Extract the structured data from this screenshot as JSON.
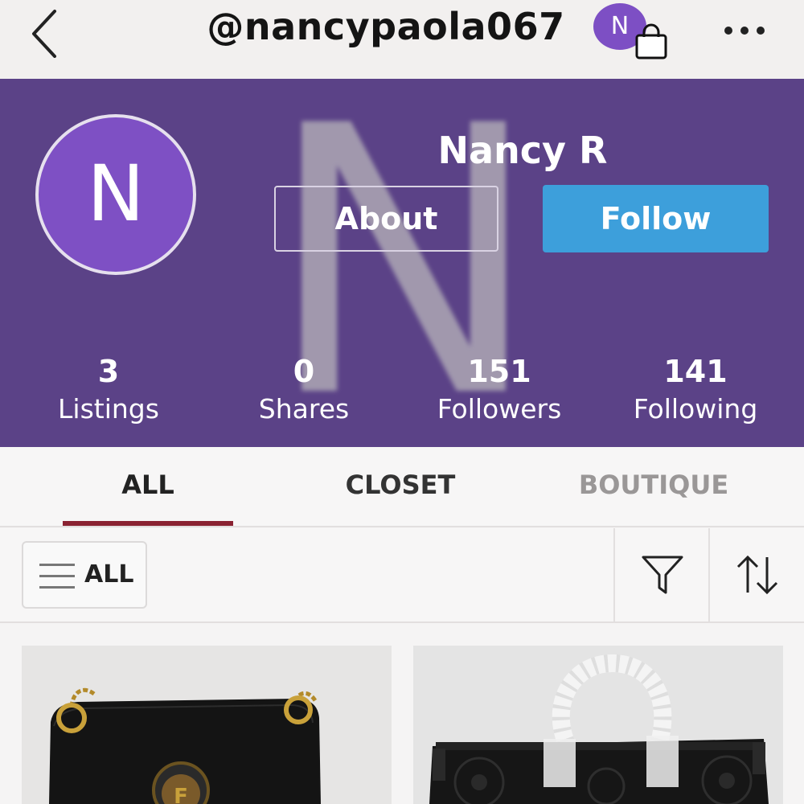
{
  "header": {
    "username": "@nancypaola067",
    "mini_avatar_letter": "N",
    "icons": [
      "back-chevron-icon",
      "shopping-bag-icon",
      "more-icon"
    ]
  },
  "profile": {
    "avatar_letter": "N",
    "display_name": "Nancy R",
    "about_label": "About",
    "follow_label": "Follow",
    "background_letter": "N",
    "colors": {
      "hero_bg": "#5b4287",
      "avatar_bg": "#7e50c4",
      "follow_bg": "#3d9fdb"
    },
    "stats": [
      {
        "value": "3",
        "label": "Listings"
      },
      {
        "value": "0",
        "label": "Shares"
      },
      {
        "value": "151",
        "label": "Followers"
      },
      {
        "value": "141",
        "label": "Following"
      }
    ]
  },
  "tabs": {
    "items": [
      {
        "label": "ALL",
        "active": true
      },
      {
        "label": "CLOSET",
        "active": false
      },
      {
        "label": "BOUTIQUE",
        "active": false
      }
    ],
    "accent": "#8a2232"
  },
  "filter_bar": {
    "category_label": "ALL",
    "icons": [
      "menu-icon",
      "filter-icon",
      "sort-icon"
    ]
  },
  "listings": [
    {
      "image": "black-handbag-gold-chain-photo"
    },
    {
      "image": "black-embossed-tote-bag-photo"
    }
  ]
}
